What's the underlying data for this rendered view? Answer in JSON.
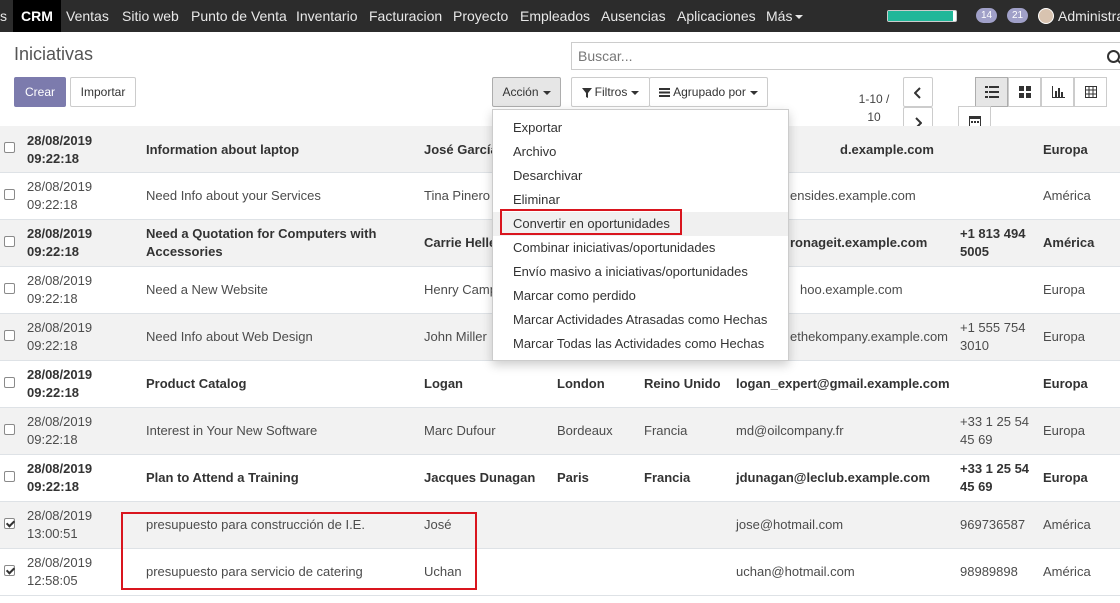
{
  "topbar": {
    "items": [
      {
        "label": "s"
      },
      {
        "label": "CRM"
      },
      {
        "label": "Ventas"
      },
      {
        "label": "Sitio web"
      },
      {
        "label": "Punto de Venta"
      },
      {
        "label": "Inventario"
      },
      {
        "label": "Facturacion"
      },
      {
        "label": "Proyecto"
      },
      {
        "label": "Empleados"
      },
      {
        "label": "Ausencias"
      },
      {
        "label": "Aplicaciones"
      },
      {
        "label": "Más"
      }
    ],
    "progress": 0.95,
    "badge_messages": "14",
    "badge_activities": "21",
    "user_label": "Administra"
  },
  "control_panel": {
    "title": "Iniciativas",
    "create_label": "Crear",
    "import_label": "Importar",
    "action_label": "Acción",
    "filters_label": "Filtros",
    "group_label": "Agrupado por",
    "search_placeholder": "Buscar...",
    "pager_line1": "1-10 /",
    "pager_line2": "10"
  },
  "action_menu": {
    "items": [
      "Exportar",
      "Archivo",
      "Desarchivar",
      "Eliminar",
      "Convertir en oportunidades",
      "Combinar iniciativas/oportunidades",
      "Envío masivo a iniciativas/oportunidades",
      "Marcar como perdido",
      "Marcar Actividades Atrasadas como Hechas",
      "Marcar Todas las Actividades como Hechas"
    ]
  },
  "rows": [
    {
      "date": "28/08/2019",
      "time": "09:22:18",
      "name": "Information about laptop",
      "contact": "José García",
      "city": "",
      "country": "",
      "email": "d.example.com",
      "phone": "",
      "region": "Europa",
      "bold": true,
      "checked": false
    },
    {
      "date": "28/08/2019",
      "time": "09:22:18",
      "name": "Need Info about your Services",
      "contact": "Tina Pinero",
      "city": "",
      "country": "",
      "email": "ensides.example.com",
      "phone": "",
      "region": "América",
      "bold": false,
      "checked": false
    },
    {
      "date": "28/08/2019",
      "time": "09:22:18",
      "name": "Need a Quotation for Computers with Accessories",
      "contact": "Carrie Helle",
      "city": "",
      "country": "",
      "email": "ronageit.example.com",
      "phone": "+1 813 494 5005",
      "region": "América",
      "bold": true,
      "checked": false
    },
    {
      "date": "28/08/2019",
      "time": "09:22:18",
      "name": "Need a New Website",
      "contact": "Henry Camp",
      "city": "",
      "country": "",
      "email": "hoo.example.com",
      "phone": "",
      "region": "Europa",
      "bold": false,
      "checked": false
    },
    {
      "date": "28/08/2019",
      "time": "09:22:18",
      "name": "Need Info about Web Design",
      "contact": "John Miller",
      "city": "",
      "country": "",
      "email": "ethekompany.example.com",
      "phone": "+1 555 754 3010",
      "region": "Europa",
      "bold": false,
      "checked": false
    },
    {
      "date": "28/08/2019",
      "time": "09:22:18",
      "name": "Product Catalog",
      "contact": "Logan",
      "city": "London",
      "country": "Reino Unido",
      "email": "logan_expert@gmail.example.com",
      "phone": "",
      "region": "Europa",
      "bold": true,
      "checked": false
    },
    {
      "date": "28/08/2019",
      "time": "09:22:18",
      "name": "Interest in Your New Software",
      "contact": "Marc Dufour",
      "city": "Bordeaux",
      "country": "Francia",
      "email": "md@oilcompany.fr",
      "phone": "+33 1 25 54 45 69",
      "region": "Europa",
      "bold": false,
      "checked": false
    },
    {
      "date": "28/08/2019",
      "time": "09:22:18",
      "name": "Plan to Attend a Training",
      "contact": "Jacques Dunagan",
      "city": "Paris",
      "country": "Francia",
      "email": "jdunagan@leclub.example.com",
      "phone": "+33 1 25 54 45 69",
      "region": "Europa",
      "bold": true,
      "checked": false
    },
    {
      "date": "28/08/2019",
      "time": "13:00:51",
      "name": "presupuesto para construcción de I.E.",
      "contact": "José",
      "city": "",
      "country": "",
      "email": "jose@hotmail.com",
      "phone": "969736587",
      "region": "América",
      "bold": false,
      "checked": true
    },
    {
      "date": "28/08/2019",
      "time": "12:58:05",
      "name": "presupuesto para servicio de catering",
      "contact": "Uchan",
      "city": "",
      "country": "",
      "email": "uchan@hotmail.com",
      "phone": "98989898",
      "region": "América",
      "bold": false,
      "checked": true
    }
  ],
  "colors": {
    "navbar": "#2c2c2c",
    "primary": "#7c7bad",
    "highlight_red": "#d9151e",
    "progress_green": "#21b799"
  }
}
